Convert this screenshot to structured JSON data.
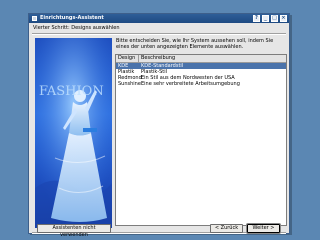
{
  "window": {
    "title": "Einrichtungs-Assistent",
    "step_title": "Vierter Schritt: Designs auswählen"
  },
  "main": {
    "intro": "Bitte entscheiden Sie, wie Ihr System aussehen soll, indem Sie eines der unten angezeigten Elemente auswählen.",
    "image_text": "FASHION"
  },
  "list": {
    "columns": [
      "Design",
      "Beschreibung"
    ],
    "rows": [
      {
        "design": "KDE",
        "description": "KDE-Standardstil",
        "selected": true
      },
      {
        "design": "Plastik",
        "description": "Plastik-Stil",
        "selected": false
      },
      {
        "design": "Redmond",
        "description": "Ein Stil aus dem Nordwesten der USA",
        "selected": false
      },
      {
        "design": "Sunshine",
        "description": "Eine sehr verbreitete Arbeitsumgebung",
        "selected": false
      }
    ]
  },
  "buttons": {
    "skip": "Assistenten nicht verwenden",
    "back": "< Zurück",
    "next": "Weiter >"
  },
  "icons": {
    "window_menu": "window-menu-icon",
    "help": "help-icon",
    "minimize": "minimize-icon",
    "maximize": "maximize-icon",
    "close": "close-icon"
  },
  "colors": {
    "titlebar": "#1e4a82",
    "selection": "#4a73ab",
    "desktop": "#5b87b3"
  }
}
